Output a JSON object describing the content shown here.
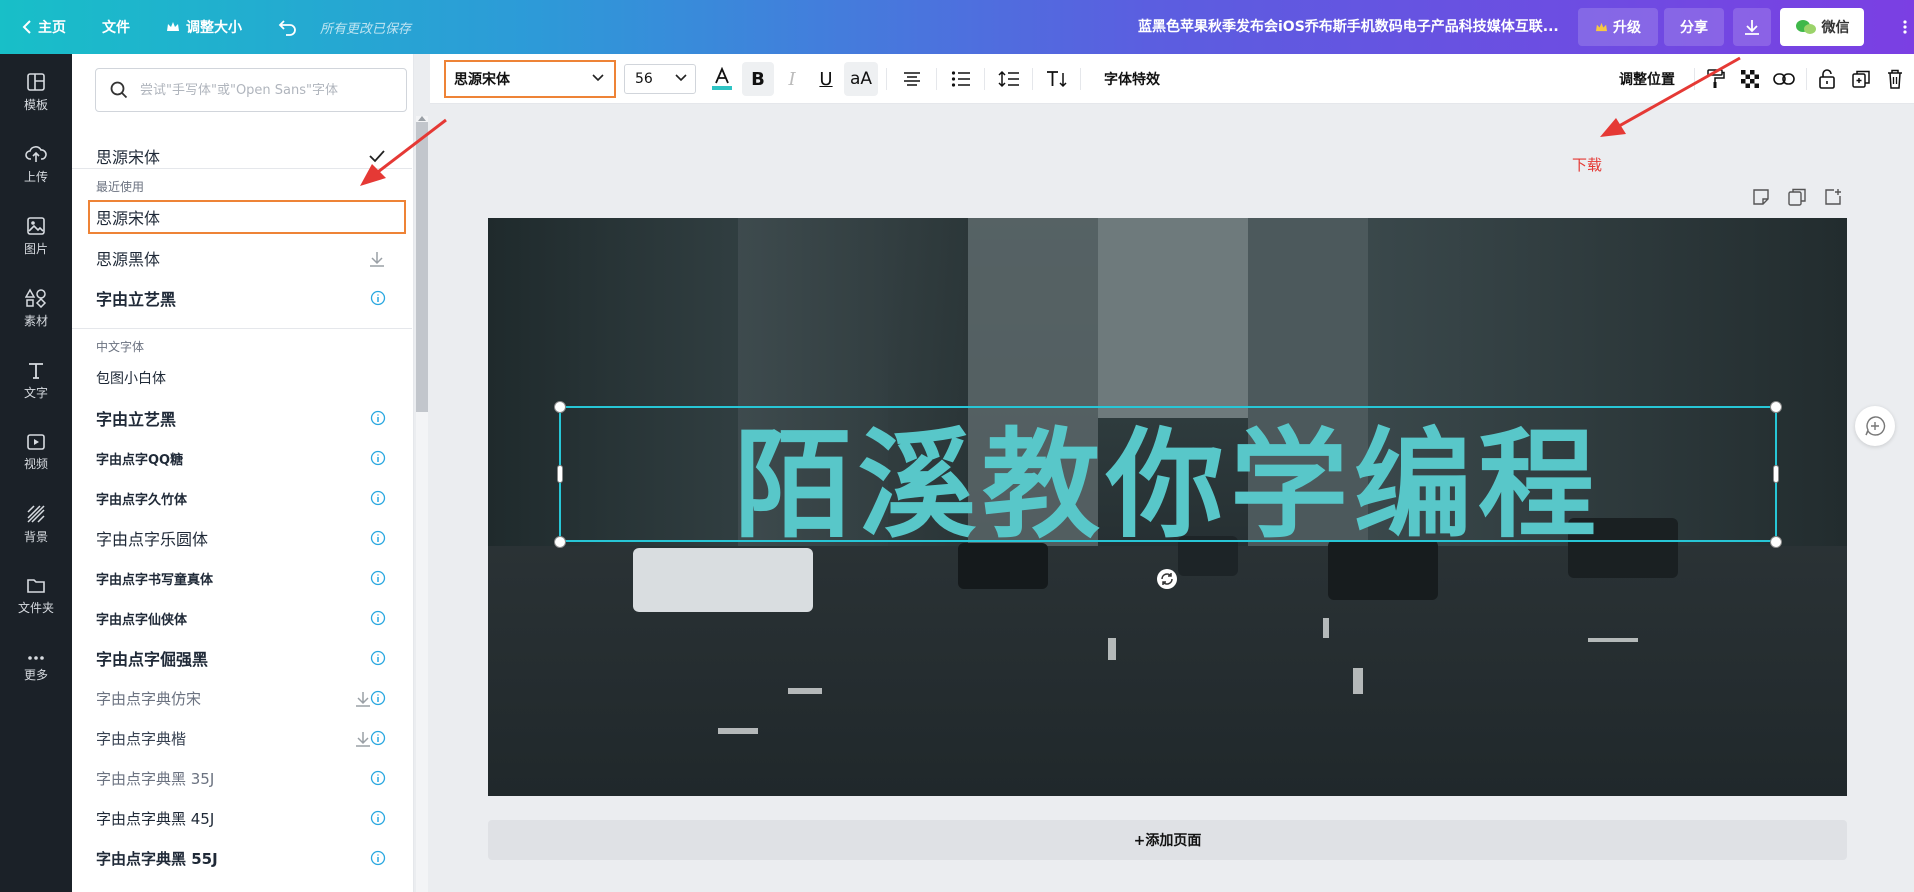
{
  "topbar": {
    "home_label": "主页",
    "file_label": "文件",
    "resize_label": "调整大小",
    "saved_status": "所有更改已保存",
    "doc_title": "蓝黑色苹果秋季发布会iOS乔布斯手机数码电子产品科技媒体互联...",
    "upgrade_label": "升级",
    "share_label": "分享",
    "wechat_label": "微信"
  },
  "sidebar": {
    "items": [
      {
        "label": "模板",
        "icon": "template-icon"
      },
      {
        "label": "上传",
        "icon": "upload-icon"
      },
      {
        "label": "图片",
        "icon": "image-icon"
      },
      {
        "label": "素材",
        "icon": "elements-icon"
      },
      {
        "label": "文字",
        "icon": "text-icon"
      },
      {
        "label": "视频",
        "icon": "video-icon"
      },
      {
        "label": "背景",
        "icon": "background-icon"
      },
      {
        "label": "文件夹",
        "icon": "folder-icon"
      },
      {
        "label": "更多",
        "icon": "more-icon"
      }
    ]
  },
  "font_panel": {
    "search_placeholder": "尝试\"手写体\"或\"Open Sans\"字体",
    "current_font": "思源宋体",
    "recent_section": "最近使用",
    "recent": [
      "思源宋体",
      "思源黑体",
      "字由立艺黑"
    ],
    "chinese_section": "中文字体",
    "chinese": [
      "包图小白体",
      "字由立艺黑",
      "字由点字QQ糖",
      "字由点字久竹体",
      "字由点字乐圆体",
      "字由点字书写童真体",
      "字由点字仙侠体",
      "字由点字倔强黑",
      "字由点字典仿宋",
      "字由点字典楷",
      "字由点字典黑 35J",
      "字由点字典黑 45J",
      "字由点字典黑 55J"
    ]
  },
  "toolbar": {
    "font_family": "思源宋体",
    "font_size": "56",
    "effects_label": "字体特效",
    "position_label": "调整位置"
  },
  "canvas": {
    "headline": "陌溪教你学编程"
  },
  "add_page_label": "+添加页面",
  "annotation_label": "下载",
  "colors": {
    "accent_orange": "#ee8336",
    "selection_cyan": "#27c6d6",
    "headline_teal": "#58c7c9",
    "arrow_red": "#e53935"
  }
}
